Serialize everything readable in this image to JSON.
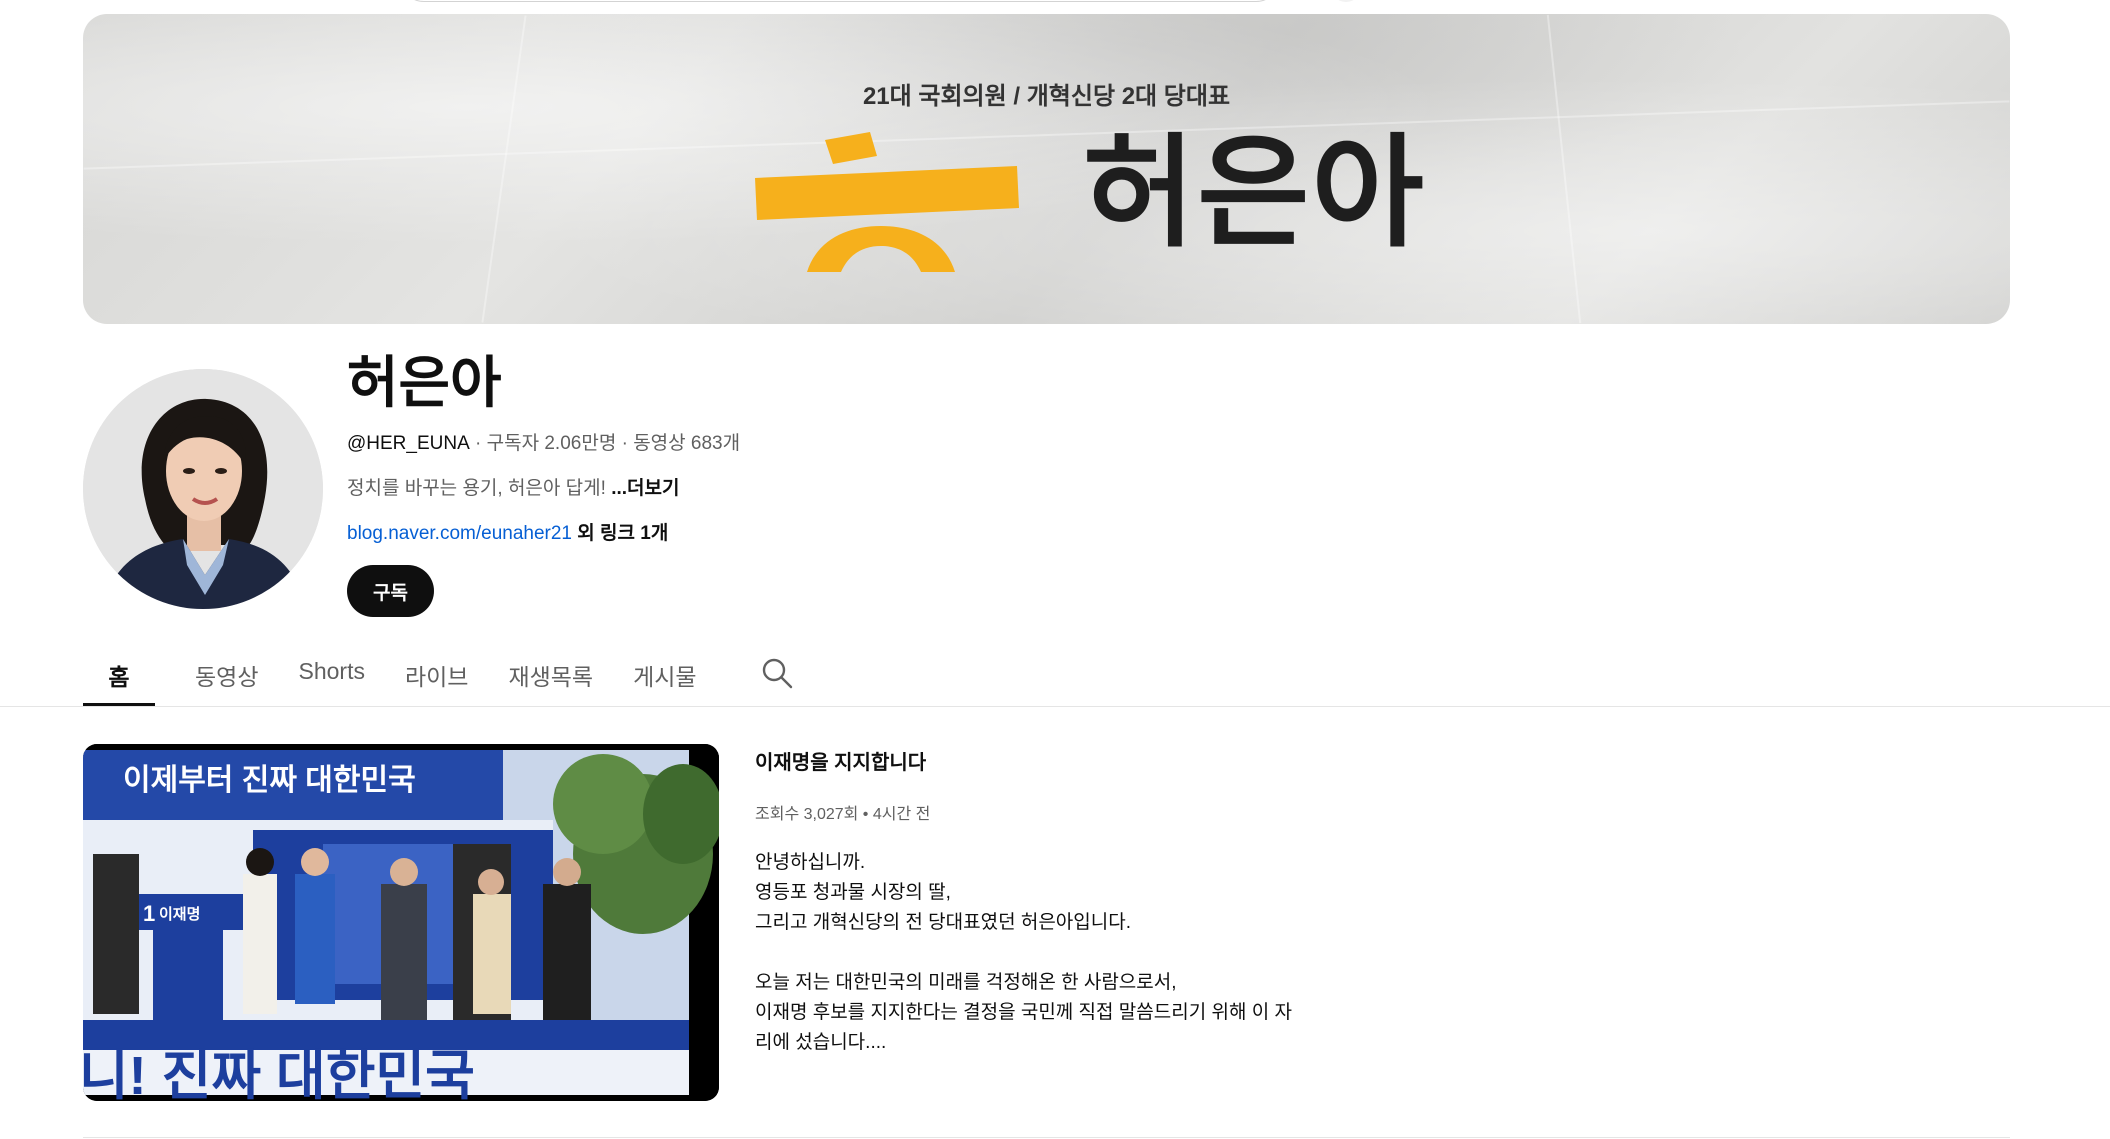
{
  "banner": {
    "subtitle": "21대 국회의원 / 개혁신당 2대 당대표",
    "name": "허은아",
    "accent_color": "#f6b01c"
  },
  "channel": {
    "title": "허은아",
    "handle": "@HER_EUNA",
    "subscribers": " · 구독자 2.06만명 · 동영상 683개",
    "description": "정치를 바꾸는 용기, 허은아 답게! ",
    "more_label": "...더보기",
    "link": "blog.naver.com/eunaher21",
    "extra_links": " 외 링크 1개",
    "subscribe_label": "구독"
  },
  "tabs": [
    {
      "label": "홈",
      "active": true
    },
    {
      "label": "동영상"
    },
    {
      "label": "Shorts"
    },
    {
      "label": "라이브"
    },
    {
      "label": "재생목록"
    },
    {
      "label": "게시물"
    }
  ],
  "tab_search_icon": "search-icon",
  "featured_video": {
    "title": "이재명을 지지합니다",
    "meta": "조회수 3,027회 • 4시간 전",
    "description_lines": [
      "안녕하십니까.",
      "영등포 청과물 시장의 딸,",
      "그리고 개혁신당의 전 당대표였던 허은아입니다.",
      "",
      "오늘 저는 대한민국의 미래를 걱정해온 한 사람으로서,",
      "이재명 후보를 지지한다는 결정을 국민께 직접 말씀드리기 위해 이 자",
      "리에 섰습니다...."
    ],
    "thumbnail": {
      "top_banner": "이제부터 진짜 대한민국",
      "bottom_banner": "니! 진짜 대한민국",
      "sign_number": "1",
      "sign_name": "이재명",
      "brand_color": "#1d3f9e"
    }
  }
}
